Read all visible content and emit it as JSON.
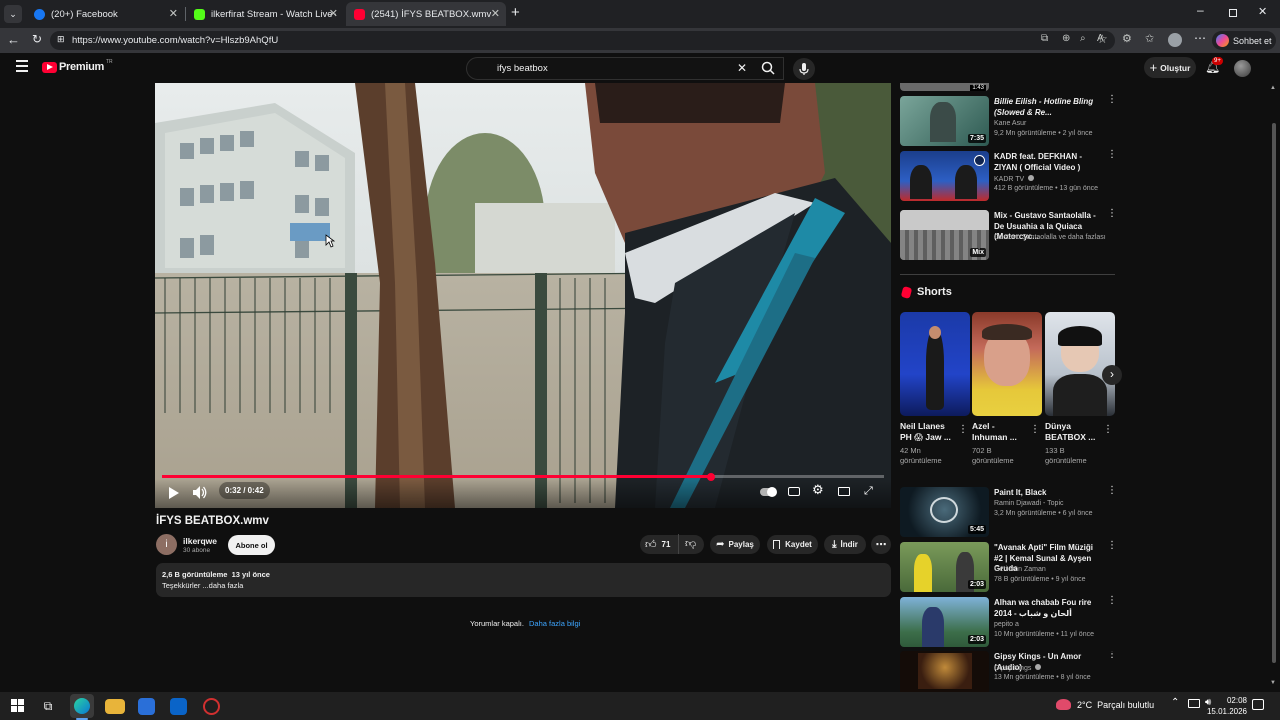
{
  "browser": {
    "tabs": [
      {
        "label": "(20+) Facebook",
        "color": "#1877f2"
      },
      {
        "label": "ilkerfirat Stream - Watch Live on K",
        "color": "#53fc18"
      },
      {
        "label": "(2541) İFYS BEATBOX.wmv - YouTu",
        "color": "#ff0033"
      }
    ],
    "url": "https://www.youtube.com/watch?v=Hlszb9AhQfU",
    "chat_button": "Sohbet et"
  },
  "yt_header": {
    "logo": "Premium",
    "logo_sup": "TR",
    "search_value": "ifys beatbox",
    "create_label": "Oluştur",
    "notif_count": "9+"
  },
  "player": {
    "time": "0:32 / 0:42",
    "progress": 0.76
  },
  "video": {
    "title": "İFYS BEATBOX.wmv",
    "channel": "ilkerqwe",
    "subs": "30 abone",
    "avatar_letter": "i",
    "subscribe": "Abone ol",
    "likes": "71",
    "share": "Paylaş",
    "save": "Kaydet",
    "download": "İndir",
    "views_date": "2,6 B görüntüleme  13 yıl önce",
    "description": "Teşekkürler ...daha fazla",
    "comments_off": "Yorumlar kapalı.",
    "learn_more": "Daha fazla bilgi"
  },
  "recs_top": [
    {
      "title": "Billie Eilish - Hotline Bling (Slowed & Re...",
      "channel": "Kane Asur",
      "meta": "9,2 Mn görüntüleme • 2 yıl önce",
      "duration": "7:35"
    },
    {
      "title": "KADR feat. DEFKHAN - ZIYAN ( Official Video )",
      "channel": "KADR TV",
      "meta": "412 B görüntüleme • 13 gün önce",
      "duration": ""
    },
    {
      "title": "Mix - Gustavo Santaolalla - De Usuahia a la Quiaca (Motorcyc...",
      "channel": "Gustavo Santaolalla ve daha fazlası",
      "meta": "",
      "duration": "Mix"
    }
  ],
  "shorts": {
    "header": "Shorts",
    "items": [
      {
        "title": "Neil Llanes PH 😱 Jaw ...",
        "meta": "42 Mn görüntüleme"
      },
      {
        "title": "Azel - Inhuman ...",
        "meta": "702 B görüntüleme"
      },
      {
        "title": "Dünya BEATBOX ...",
        "meta": "133 B görüntüleme"
      }
    ]
  },
  "recs_bottom": [
    {
      "title": "Paint It, Black",
      "channel": "Ramin Djawadi - Topic",
      "meta": "3,2 Mn görüntüleme • 6 yıl önce",
      "duration": "5:45"
    },
    {
      "title": "\"Avanak Apti\" Film Müziği #2 | Kemal Sunal & Ayşen Gruda",
      "channel": "Geri Dön Zaman",
      "meta": "78 B görüntüleme • 9 yıl önce",
      "duration": "2:03"
    },
    {
      "title": "Alhan wa chabab Fou rire 2014 - ألحان و شباب",
      "channel": "pepito a",
      "meta": "10 Mn görüntüleme • 11 yıl önce",
      "duration": "2:03"
    },
    {
      "title": "Gipsy Kings - Un Amor (Audio)",
      "channel": "Gipsy Kings",
      "meta": "13 Mn görüntüleme • 8 yıl önce",
      "duration": ""
    }
  ],
  "taskbar": {
    "weather": "2°C  Parçalı bulutlu",
    "time": "02:08",
    "date": "15.01.2026"
  }
}
